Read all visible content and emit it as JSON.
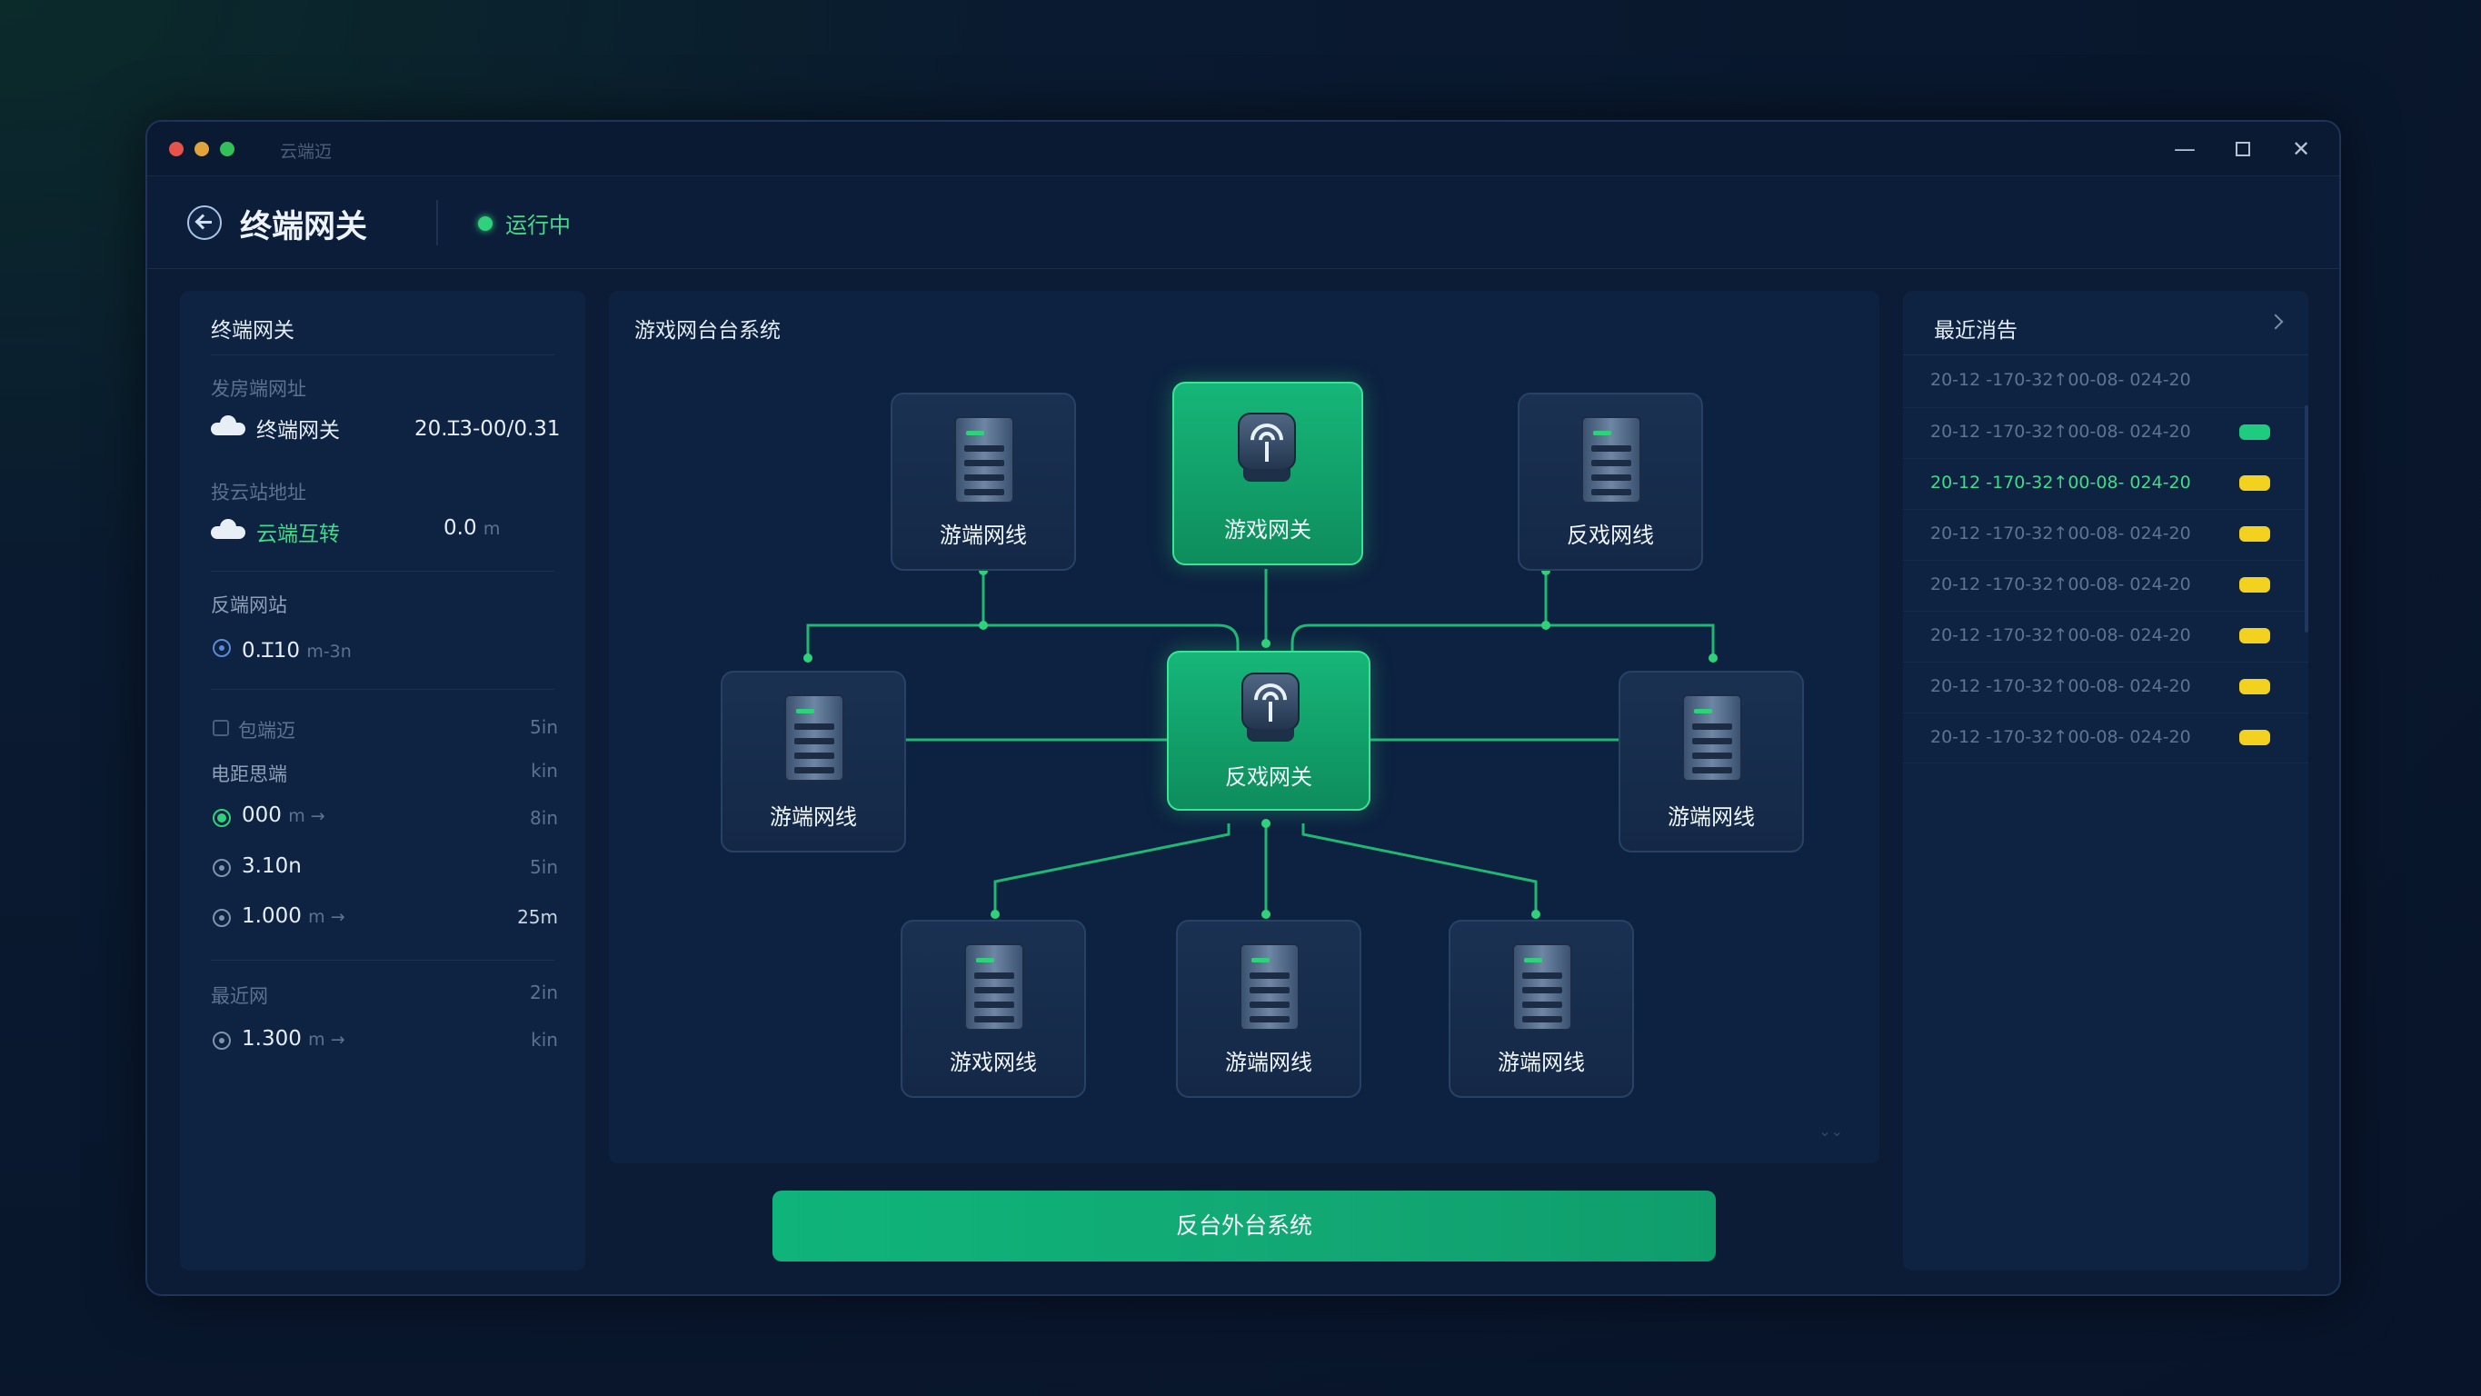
{
  "window": {
    "title": "云端迈"
  },
  "header": {
    "title": "终端网关",
    "status": "运行中"
  },
  "left": {
    "title": "终端网关",
    "sec1_label": "发房端网址",
    "sec1_name": "终端网关",
    "sec1_value": "20.Ɪ3-00/0.31",
    "sec2_label": "投云站地址",
    "sec2_name": "云端互转",
    "sec2_value": "0.0",
    "sec2_unit": "m",
    "sec3_label": "反端网站",
    "sec3_value": "0.Ɪ10",
    "sec3_unit": "m-3n",
    "row1_label": "包端迈",
    "row1_right": "5in",
    "row2_label": "电距思端",
    "row2_right": "kin",
    "row3_value": "000",
    "row3_unit": "m  →",
    "row3_right": "8in",
    "row4_value": "3.10n",
    "row4_right": "5in",
    "row5_value": "1.000",
    "row5_unit": "m  →",
    "row5_right": "25m",
    "sec4_label": "最近网",
    "sec4_right": "2in",
    "row6_value": "1.300",
    "row6_unit": "m  →",
    "row6_right": "kin"
  },
  "center": {
    "title": "游戏网台台系统",
    "nodes": {
      "top_left": "游端网线",
      "top_center": "游戏网关",
      "top_right": "反戏网线",
      "mid_left": "游端网线",
      "hub": "反戏网关",
      "mid_right": "游端网线",
      "bottom_left": "游戏网线",
      "bottom_center": "游端网线",
      "bottom_right": "游端网线"
    },
    "corner": "⌄⌄"
  },
  "action": {
    "label": "反台外台系统"
  },
  "right": {
    "title": "最近消告",
    "logs": [
      {
        "text": "20-12 -170-32↑00-08- 024-20",
        "badge": ""
      },
      {
        "text": "20-12 -170-32↑00-08- 024-20",
        "badge": "green"
      },
      {
        "text": "20-12 -170-32↑00-08- 024-20",
        "badge": "yellow",
        "highlight": true
      },
      {
        "text": "20-12 -170-32↑00-08- 024-20",
        "badge": "yellow"
      },
      {
        "text": "20-12 -170-32↑00-08- 024-20",
        "badge": "yellow"
      },
      {
        "text": "20-12 -170-32↑00-08- 024-20",
        "badge": "yellow"
      },
      {
        "text": "20-12 -170-32↑00-08- 024-20",
        "badge": "yellow"
      },
      {
        "text": "20-12 -170-32↑00-08- 024-20",
        "badge": "yellow"
      }
    ]
  },
  "colors": {
    "accent": "#2fd27a",
    "warning": "#f2d21f",
    "panel": "#0e2241",
    "background": "#08142a"
  }
}
